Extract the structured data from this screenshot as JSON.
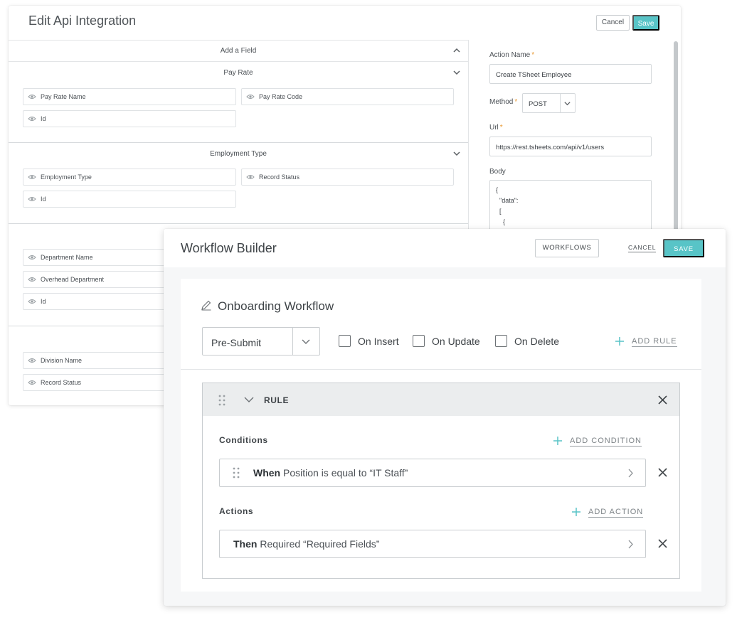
{
  "api": {
    "title": "Edit Api Integration",
    "cancel_label": "Cancel",
    "save_label": "Save",
    "add_field_label": "Add a Field",
    "sections": [
      {
        "title": "Pay Rate",
        "fields": [
          "Pay Rate Name",
          "Pay Rate Code",
          "Id"
        ]
      },
      {
        "title": "Employment Type",
        "fields": [
          "Employment Type",
          "Record Status",
          "Id"
        ]
      },
      {
        "title": "",
        "fields": [
          "Department Name",
          "Overhead Department",
          "Id"
        ]
      },
      {
        "title": "",
        "fields": [
          "Division Name",
          "Record Status"
        ]
      }
    ],
    "action_name_label": "Action Name",
    "action_name_value": "Create TSheet Employee",
    "method_label": "Method",
    "method_value": "POST",
    "url_label": "Url",
    "url_value": "https://rest.tsheets.com/api/v1/users",
    "body_label": "Body",
    "body_value": "{\n  \"data\":\n  [\n    {",
    "required_mark": "*"
  },
  "workflow": {
    "title": "Workflow Builder",
    "workflows_label": "WORKFLOWS",
    "cancel_label": "CANCEL",
    "save_label": "SAVE",
    "name": "Onboarding Workflow",
    "trigger_value": "Pre-Submit",
    "checkboxes": [
      "On Insert",
      "On Update",
      "On Delete"
    ],
    "add_rule_label": "ADD RULE",
    "rule_label": "RULE",
    "conditions_label": "Conditions",
    "add_condition_label": "ADD CONDITION",
    "condition": {
      "keyword": "When",
      "text": "Position is equal to “IT Staff”"
    },
    "actions_label": "Actions",
    "add_action_label": "ADD ACTION",
    "action": {
      "keyword": "Then",
      "text": "Required “Required Fields”"
    }
  },
  "colors": {
    "accent": "#58c4c7",
    "required": "#e8972f"
  },
  "icons": [
    "eye-icon",
    "chevron-down-icon",
    "chevron-up-icon",
    "pencil-icon",
    "plus-icon",
    "drag-handle-icon",
    "close-icon",
    "chevron-right-icon"
  ]
}
